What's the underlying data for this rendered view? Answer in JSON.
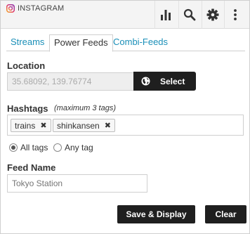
{
  "header": {
    "brand_label": "INSTAGRAM",
    "brand_icon": "instagram-icon",
    "actions": [
      {
        "name": "stats",
        "icon": "bar-chart-icon"
      },
      {
        "name": "search",
        "icon": "search-icon"
      },
      {
        "name": "settings",
        "icon": "gear-icon"
      },
      {
        "name": "more",
        "icon": "vertical-dots-icon"
      }
    ]
  },
  "tabs": [
    {
      "label": "Streams",
      "active": false
    },
    {
      "label": "Power Feeds",
      "active": true
    },
    {
      "label": "Combi-Feeds",
      "active": false
    }
  ],
  "location": {
    "label": "Location",
    "value": "35.68092, 139.76774",
    "select_label": "Select",
    "select_icon": "globe-icon"
  },
  "hashtags": {
    "label": "Hashtags",
    "hint": "(maximum 3 tags)",
    "tags": [
      "trains",
      "shinkansen"
    ],
    "remove_icon": "close-icon"
  },
  "match_mode": {
    "options": [
      {
        "label": "All tags",
        "selected": true
      },
      {
        "label": "Any tag",
        "selected": false
      }
    ]
  },
  "feed_name": {
    "label": "Feed Name",
    "placeholder": "Tokyo Station"
  },
  "actions": {
    "save_label": "Save & Display",
    "clear_label": "Clear"
  },
  "colors": {
    "link_tab": "#1a8fb8",
    "button_bg": "#1f1f1f",
    "header_bg": "#f4f4f4"
  }
}
